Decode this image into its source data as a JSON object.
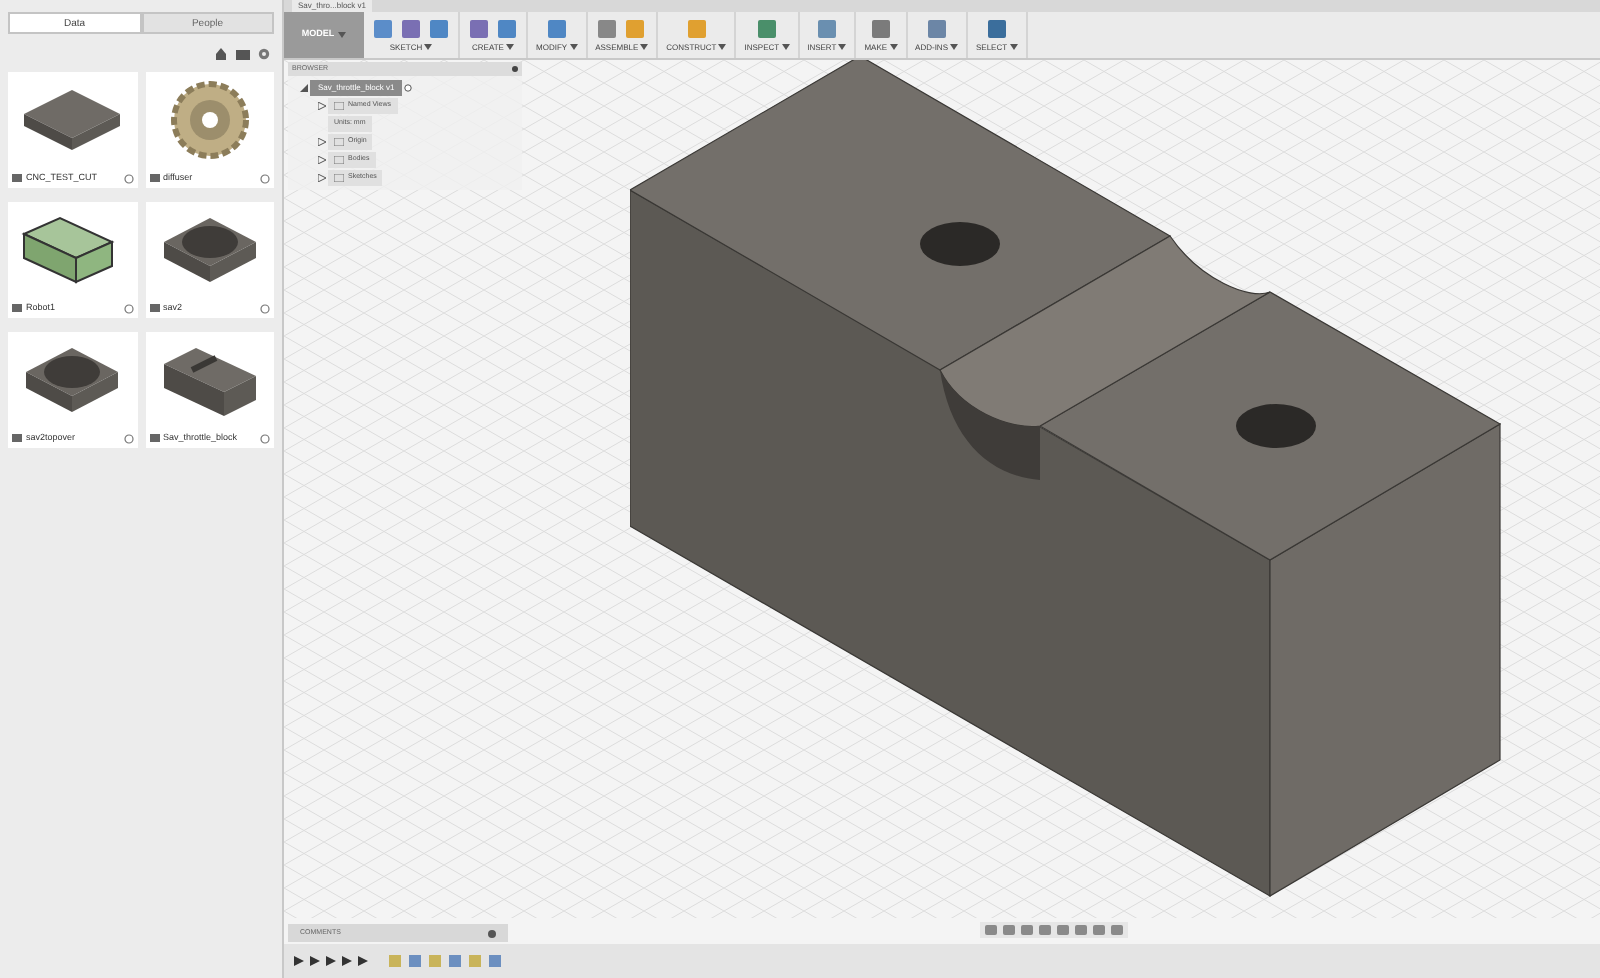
{
  "data_panel": {
    "tabs": [
      {
        "label": "Data",
        "selected": true
      },
      {
        "label": "People",
        "selected": false
      }
    ],
    "files": [
      {
        "name": "CNC_TEST_CUT",
        "kind": "plate"
      },
      {
        "name": "diffuser",
        "kind": "wheel"
      },
      {
        "name": "Robot1",
        "kind": "box"
      },
      {
        "name": "sav2",
        "kind": "ring"
      },
      {
        "name": "sav2topover",
        "kind": "ring"
      },
      {
        "name": "Sav_throttle_block",
        "kind": "block"
      }
    ]
  },
  "document_tab": {
    "title": "Sav_thro...block v1"
  },
  "toolbar": {
    "workspace": "MODEL",
    "groups": [
      {
        "label": "SKETCH"
      },
      {
        "label": "CREATE"
      },
      {
        "label": "MODIFY"
      },
      {
        "label": "ASSEMBLE"
      },
      {
        "label": "CONSTRUCT"
      },
      {
        "label": "INSPECT"
      },
      {
        "label": "INSERT"
      },
      {
        "label": "MAKE"
      },
      {
        "label": "ADD-INS"
      },
      {
        "label": "SELECT"
      }
    ]
  },
  "browser": {
    "title": "BROWSER",
    "root": {
      "label": "Sav_throttle_block v1",
      "expanded": true,
      "children": [
        {
          "label": "Named Views",
          "kind": "folder",
          "expanded": false
        },
        {
          "label": "Units: mm",
          "kind": "units"
        },
        {
          "label": "Origin",
          "kind": "folder",
          "expanded": false
        },
        {
          "label": "Bodies",
          "kind": "folder",
          "expanded": false
        },
        {
          "label": "Sketches",
          "kind": "folder",
          "expanded": false
        }
      ]
    }
  },
  "comments": {
    "title": "COMMENTS"
  }
}
